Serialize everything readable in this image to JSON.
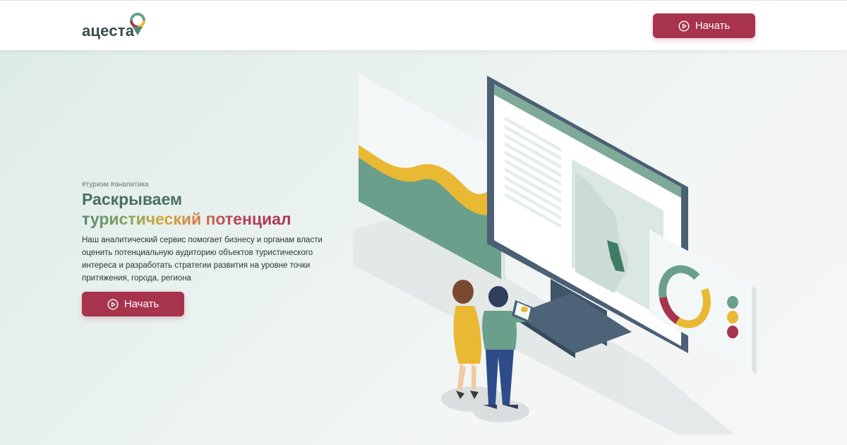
{
  "header": {
    "logo_text": "ацеста",
    "start_label": "Начать"
  },
  "hero": {
    "tags": "#туризм #аналитика",
    "title_line1": "Раскрываем",
    "title_line2": "туристический потенциал",
    "description": "Наш аналитический сервис помогает бизнесу и органам власти оценить потенциальную аудиторию объектов туристического интереса и разработать стратегии развития на уровне точки притяжения, города, региона",
    "start_label": "Начать"
  },
  "colors": {
    "accent": "#a8334c",
    "green": "#6a9f8c",
    "yellow": "#e9b934",
    "dark_green_text": "#4a6f64"
  },
  "icons": {
    "play": "play-circle-icon",
    "logo_mark": "map-pin-donut-icon"
  }
}
